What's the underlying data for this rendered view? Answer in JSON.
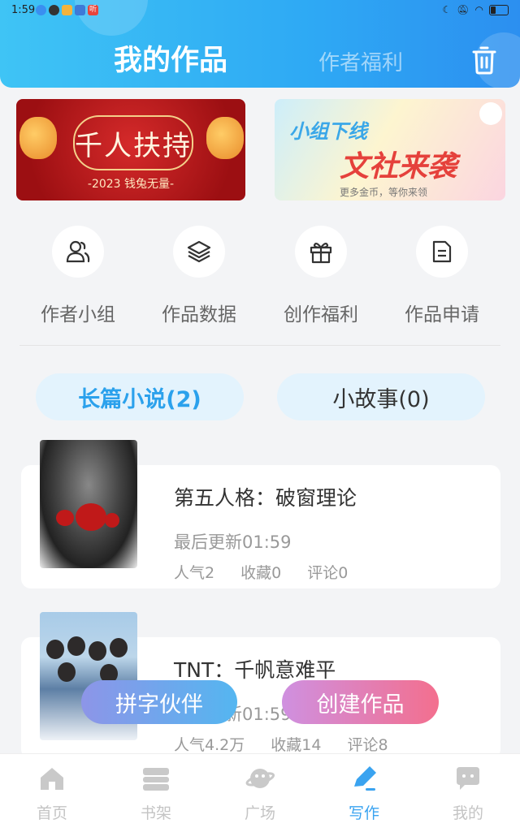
{
  "status_bar": {
    "time": "1:59",
    "app_badge": "听"
  },
  "header": {
    "tab_active": "我的作品",
    "tab_inactive": "作者福利"
  },
  "banners": [
    {
      "title": "千人扶持",
      "subtitle": "-2023 钱兔无量-"
    },
    {
      "title_top": "小组下线",
      "title_big": "文社来袭",
      "subtitle": "更多金币，等你来领"
    }
  ],
  "quick_actions": [
    {
      "label": "作者小组",
      "icon": "people-icon"
    },
    {
      "label": "作品数据",
      "icon": "layers-icon"
    },
    {
      "label": "创作福利",
      "icon": "gift-icon"
    },
    {
      "label": "作品申请",
      "icon": "document-icon"
    }
  ],
  "category_tabs": [
    {
      "label": "长篇小说(2)",
      "active": true
    },
    {
      "label": "小故事(0)",
      "active": false
    }
  ],
  "works": [
    {
      "title": "第五人格：破窗理论",
      "updated": "最后更新01:59",
      "popularity": "人气2",
      "favorites": "收藏0",
      "comments": "评论0"
    },
    {
      "title": "TNT：千帆意难平",
      "updated": "最后更新01:59",
      "popularity": "人气4.2万",
      "favorites": "收藏14",
      "comments": "评论8"
    }
  ],
  "floating_buttons": {
    "left": "拼字伙伴",
    "right": "创建作品"
  },
  "tab_bar": [
    {
      "label": "首页",
      "icon": "home-icon"
    },
    {
      "label": "书架",
      "icon": "bookshelf-icon"
    },
    {
      "label": "广场",
      "icon": "planet-icon"
    },
    {
      "label": "写作",
      "icon": "pen-icon",
      "active": true
    },
    {
      "label": "我的",
      "icon": "chat-bubble-icon"
    }
  ],
  "colors": {
    "primary": "#2ba1ec",
    "header_start": "#3fc4f5",
    "header_end": "#2c8ff0",
    "create_btn": "#f36f8e"
  }
}
